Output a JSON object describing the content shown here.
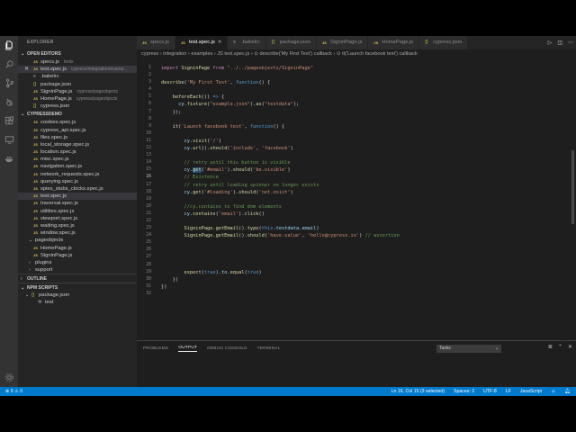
{
  "explorer": {
    "title": "EXPLORER",
    "open_editors_label": "OPEN EDITORS",
    "open_editors": [
      {
        "icon": "js",
        "name": "specs.js",
        "hint": "tests"
      },
      {
        "icon": "js",
        "name": "test.spec.js",
        "hint": "cypress/integration/examp...",
        "close": "✕",
        "selected": true
      },
      {
        "icon": "dot",
        "name": ".babelrc",
        "hint": ""
      },
      {
        "icon": "json",
        "name": "package.json",
        "hint": ""
      },
      {
        "icon": "js",
        "name": "SigninPage.js",
        "hint": "cypress/pageobjects"
      },
      {
        "icon": "js",
        "name": "HomePage.js",
        "hint": "cypress/pageobjects"
      },
      {
        "icon": "json",
        "name": "cypress.json",
        "hint": ""
      }
    ],
    "project_label": "CYPRESSDEMO",
    "project_files": [
      {
        "icon": "js",
        "name": "cookies.spec.js"
      },
      {
        "icon": "js",
        "name": "cypress_api.spec.js"
      },
      {
        "icon": "js",
        "name": "files.spec.js"
      },
      {
        "icon": "js",
        "name": "local_storage.spec.js"
      },
      {
        "icon": "js",
        "name": "location.spec.js"
      },
      {
        "icon": "js",
        "name": "misc.spec.js"
      },
      {
        "icon": "js",
        "name": "navigation.spec.js"
      },
      {
        "icon": "js",
        "name": "network_requests.spec.js"
      },
      {
        "icon": "js",
        "name": "querying.spec.js"
      },
      {
        "icon": "js",
        "name": "spies_stubs_clocks.spec.js"
      },
      {
        "icon": "js",
        "name": "test.spec.js",
        "selected": true
      },
      {
        "icon": "js",
        "name": "traversal.spec.js"
      },
      {
        "icon": "js",
        "name": "utilities.spec.js"
      },
      {
        "icon": "js",
        "name": "viewport.spec.js"
      },
      {
        "icon": "js",
        "name": "waiting.spec.js"
      },
      {
        "icon": "js",
        "name": "window.spec.js"
      }
    ],
    "pageobjects_folder": "pageobjects",
    "pageobjects_files": [
      {
        "icon": "js",
        "name": "HomePage.js"
      },
      {
        "icon": "js",
        "name": "SigninPage.js"
      }
    ],
    "plugins_folder": "plugins",
    "support_folder": "support",
    "outline_label": "OUTLINE",
    "npm_label": "NPM SCRIPTS",
    "npm_package": "package.json",
    "npm_script": "test"
  },
  "tabs": [
    {
      "icon": "js",
      "label": "specs.js",
      "active": false
    },
    {
      "icon": "js",
      "label": "test.spec.js",
      "active": true,
      "close": "✕"
    },
    {
      "icon": "dot",
      "label": ".babelrc",
      "active": false
    },
    {
      "icon": "json",
      "label": "package.json",
      "active": false
    },
    {
      "icon": "js",
      "label": "SigninPage.js",
      "active": false
    },
    {
      "icon": "js",
      "label": "HomePage.js",
      "active": false
    },
    {
      "icon": "json",
      "label": "cypress.json",
      "active": false
    }
  ],
  "breadcrumb": "cypress › integration › examples › JS test.spec.js › ⊙ describe('My First Test') callback › ⊙ it('Launch facebook test') callback",
  "code": {
    "line_numbers": [
      "1",
      "2",
      "3",
      "4",
      "5",
      "6",
      "7",
      "8",
      "9",
      "10",
      "11",
      "12",
      "13",
      "14",
      "15",
      "16",
      "17",
      "18",
      "19",
      "20",
      "21",
      "22",
      "23",
      "24",
      "25",
      "26",
      "27",
      "28",
      "29",
      "30",
      "31",
      "32"
    ],
    "current_line": "16",
    "lines": [
      [
        [
          "kw",
          "import "
        ],
        [
          "fn",
          "SigninPage"
        ],
        [
          "kw",
          " from "
        ],
        [
          "str",
          "\"../../pageobjects/SigninPage\""
        ]
      ],
      [],
      [
        [
          "fn",
          "describe"
        ],
        [
          "p",
          "("
        ],
        [
          "str",
          "'My First Test'"
        ],
        [
          "p",
          ", "
        ],
        [
          "kw2",
          "function"
        ],
        [
          "p",
          "() {"
        ]
      ],
      [],
      [
        [
          "p",
          "    "
        ],
        [
          "fn",
          "beforeEach"
        ],
        [
          "p",
          "(() "
        ],
        [
          "kw2",
          "=>"
        ],
        [
          "p",
          " {"
        ]
      ],
      [
        [
          "p",
          "      "
        ],
        [
          "var",
          "cy"
        ],
        [
          "p",
          "."
        ],
        [
          "fn",
          "fixture"
        ],
        [
          "p",
          "("
        ],
        [
          "str",
          "\"example.json\""
        ],
        [
          "p",
          ")."
        ],
        [
          "fn",
          "as"
        ],
        [
          "p",
          "("
        ],
        [
          "str",
          "\"testdata\""
        ],
        [
          "p",
          ");"
        ]
      ],
      [
        [
          "p",
          "    });"
        ]
      ],
      [],
      [
        [
          "p",
          "    "
        ],
        [
          "fn",
          "it"
        ],
        [
          "p",
          "("
        ],
        [
          "str",
          "'Launch facebook test'"
        ],
        [
          "p",
          ", "
        ],
        [
          "kw2",
          "function"
        ],
        [
          "p",
          "() {"
        ]
      ],
      [],
      [
        [
          "p",
          "        "
        ],
        [
          "var",
          "cy"
        ],
        [
          "p",
          "."
        ],
        [
          "fn",
          "visit"
        ],
        [
          "p",
          "("
        ],
        [
          "str",
          "'/'"
        ],
        [
          "p",
          ")"
        ]
      ],
      [
        [
          "p",
          "        "
        ],
        [
          "var",
          "cy"
        ],
        [
          "p",
          "."
        ],
        [
          "fn",
          "url"
        ],
        [
          "p",
          "()."
        ],
        [
          "fn",
          "should"
        ],
        [
          "p",
          "("
        ],
        [
          "str",
          "'include'"
        ],
        [
          "p",
          ", "
        ],
        [
          "str",
          "'facebook'"
        ],
        [
          "p",
          ")"
        ]
      ],
      [],
      [
        [
          "p",
          "        "
        ],
        [
          "cm",
          "// retry until this button is visible"
        ]
      ],
      [
        [
          "p",
          "        "
        ],
        [
          "var",
          "cy"
        ],
        [
          "p",
          "."
        ],
        [
          "sel",
          "get"
        ],
        [
          "p",
          "("
        ],
        [
          "str",
          "'#email'"
        ],
        [
          "p",
          ")."
        ],
        [
          "fn",
          "should"
        ],
        [
          "p",
          "("
        ],
        [
          "str",
          "'be.visible'"
        ],
        [
          "p",
          ")"
        ]
      ],
      [
        [
          "p",
          "        "
        ],
        [
          "cm",
          "// Existence"
        ]
      ],
      [
        [
          "p",
          "        "
        ],
        [
          "cm",
          "// retry until loading spinner no longer exists"
        ]
      ],
      [
        [
          "p",
          "        "
        ],
        [
          "var",
          "cy"
        ],
        [
          "p",
          "."
        ],
        [
          "fn",
          "get"
        ],
        [
          "p",
          "("
        ],
        [
          "str",
          "'#loading'"
        ],
        [
          "p",
          ")."
        ],
        [
          "fn",
          "should"
        ],
        [
          "p",
          "("
        ],
        [
          "str",
          "'not.exist'"
        ],
        [
          "p",
          ")"
        ]
      ],
      [],
      [
        [
          "p",
          "        "
        ],
        [
          "cm",
          "//cy.contains to find dom elements"
        ]
      ],
      [
        [
          "p",
          "        "
        ],
        [
          "var",
          "cy"
        ],
        [
          "p",
          "."
        ],
        [
          "fn",
          "contains"
        ],
        [
          "p",
          "("
        ],
        [
          "str",
          "'email'"
        ],
        [
          "p",
          ")."
        ],
        [
          "fn",
          "click"
        ],
        [
          "p",
          "()"
        ]
      ],
      [],
      [
        [
          "p",
          "        "
        ],
        [
          "fn",
          "SigninPage"
        ],
        [
          "p",
          "."
        ],
        [
          "fn",
          "getEmail"
        ],
        [
          "p",
          "()."
        ],
        [
          "fn",
          "type"
        ],
        [
          "p",
          "("
        ],
        [
          "kw2",
          "this"
        ],
        [
          "p",
          "."
        ],
        [
          "var",
          "testdata"
        ],
        [
          "p",
          "."
        ],
        [
          "var",
          "email"
        ],
        [
          "p",
          ")"
        ]
      ],
      [
        [
          "p",
          "        "
        ],
        [
          "fn",
          "SigninPage"
        ],
        [
          "p",
          "."
        ],
        [
          "fn",
          "getEmail"
        ],
        [
          "p",
          "()."
        ],
        [
          "fn",
          "should"
        ],
        [
          "p",
          "("
        ],
        [
          "str",
          "'have.value'"
        ],
        [
          "p",
          ", "
        ],
        [
          "str",
          "'hello@cypress.io'"
        ],
        [
          "p",
          ") "
        ],
        [
          "cm",
          "// assertion"
        ]
      ],
      [],
      [],
      [],
      [],
      [
        [
          "p",
          "        "
        ],
        [
          "fn",
          "expect"
        ],
        [
          "p",
          "("
        ],
        [
          "kw2",
          "true"
        ],
        [
          "p",
          ")."
        ],
        [
          "var",
          "to"
        ],
        [
          "p",
          "."
        ],
        [
          "fn",
          "equal"
        ],
        [
          "p",
          "("
        ],
        [
          "kw2",
          "true"
        ],
        [
          "p",
          ")"
        ]
      ],
      [
        [
          "p",
          "    })"
        ]
      ],
      [
        [
          "p",
          "})"
        ]
      ],
      []
    ]
  },
  "colors": {
    "kw": "#c586c0",
    "kw2": "#569cd6",
    "fn": "#dcdcaa",
    "str": "#ce9178",
    "cm": "#6a9955",
    "var": "#9cdcfe",
    "p": "#d4d4d4",
    "sel": "#dcdcaa",
    "accent": "#007acc"
  },
  "panel": {
    "tabs": [
      {
        "label": "PROBLEMS",
        "active": false
      },
      {
        "label": "OUTPUT",
        "active": true
      },
      {
        "label": "DEBUG CONSOLE",
        "active": false
      },
      {
        "label": "TERMINAL",
        "active": false
      }
    ],
    "select_value": "Tasks"
  },
  "status": {
    "problems": "⊗ 0  ⚠ 0",
    "position": "Ln 16, Col 15 (3 selected)",
    "spaces": "Spaces: 2",
    "encoding": "UTF-8",
    "eol": "LF",
    "language": "JavaScript"
  }
}
